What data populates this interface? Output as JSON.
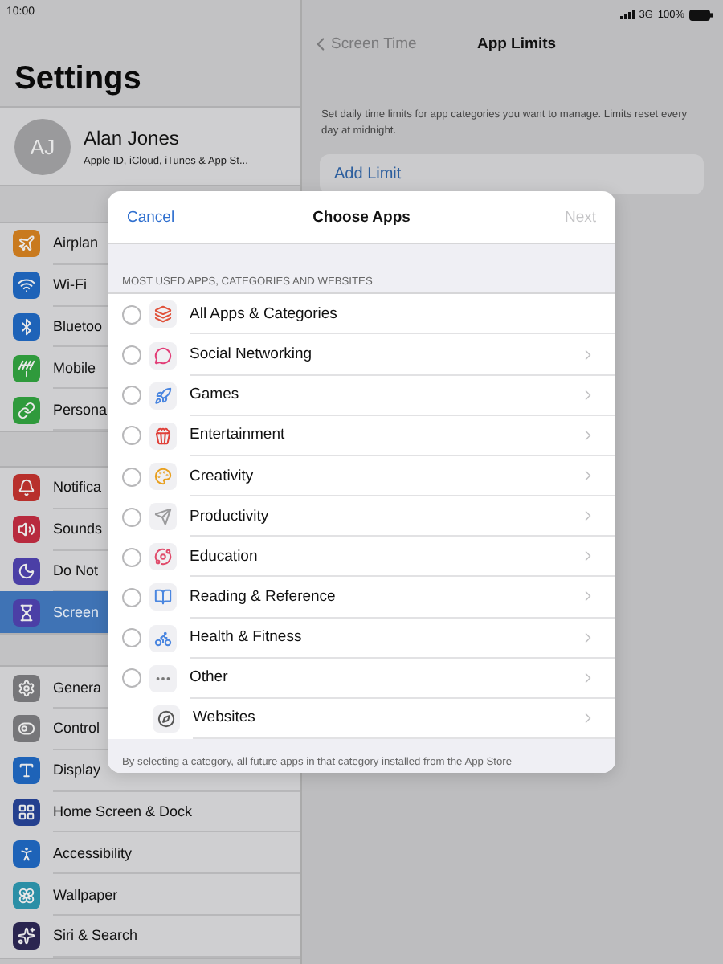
{
  "status_bar": {
    "time": "10:00",
    "network": "3G",
    "battery": "100%"
  },
  "sidebar": {
    "title": "Settings",
    "profile": {
      "initials": "AJ",
      "name": "Alan Jones",
      "subtitle": "Apple ID, iCloud, iTunes & App St..."
    },
    "groups": [
      [
        {
          "label": "Airplan",
          "color": "#c97a1e",
          "selected": false
        },
        {
          "label": "Wi-Fi",
          "color": "#1e63b8",
          "selected": false
        },
        {
          "label": "Bluetoo",
          "color": "#1e63b8",
          "selected": false
        },
        {
          "label": "Mobile",
          "color": "#2f9a3c",
          "selected": false
        },
        {
          "label": "Persona",
          "color": "#2f9a3c",
          "selected": false
        }
      ],
      [
        {
          "label": "Notifica",
          "color": "#b8302c",
          "selected": false
        },
        {
          "label": "Sounds",
          "color": "#b82a3e",
          "selected": false
        },
        {
          "label": "Do Not",
          "color": "#4b3fa6",
          "selected": false
        },
        {
          "label": "Screen",
          "color": "#4b3fa6",
          "selected": true
        }
      ],
      [
        {
          "label": "Genera",
          "color": "#767679",
          "selected": false
        },
        {
          "label": "Control",
          "color": "#767679",
          "selected": false
        },
        {
          "label": "Display",
          "color": "#1e63b8",
          "selected": false
        },
        {
          "label": "Home Screen & Dock",
          "color": "#25408f",
          "selected": false
        },
        {
          "label": "Accessibility",
          "color": "#1e63b8",
          "selected": false
        },
        {
          "label": "Wallpaper",
          "color": "#2b8fa6",
          "selected": false
        },
        {
          "label": "Siri & Search",
          "color": "#2a2550",
          "selected": false
        }
      ]
    ]
  },
  "detail": {
    "back": "Screen Time",
    "title": "App Limits",
    "description": "Set daily time limits for app categories you want to manage. Limits reset every day at midnight.",
    "action": "Add Limit"
  },
  "dialog": {
    "cancel": "Cancel",
    "title": "Choose Apps",
    "next": "Next",
    "next_disabled": true,
    "section_header": "MOST USED APPS, CATEGORIES AND WEBSITES",
    "rows": [
      {
        "kind": "radio",
        "label": "All Apps & Categories",
        "selected": false,
        "chevron": false
      },
      {
        "kind": "radio",
        "label": "Social Networking",
        "selected": false,
        "chevron": true
      },
      {
        "kind": "radio",
        "label": "Games",
        "selected": false,
        "chevron": true
      },
      {
        "kind": "radio",
        "label": "Entertainment",
        "selected": false,
        "chevron": true
      },
      {
        "kind": "radio",
        "label": "Creativity",
        "selected": false,
        "chevron": true
      },
      {
        "kind": "radio",
        "label": "Productivity",
        "selected": false,
        "chevron": true
      },
      {
        "kind": "radio",
        "label": "Education",
        "selected": false,
        "chevron": true
      },
      {
        "kind": "radio",
        "label": "Reading & Reference",
        "selected": false,
        "chevron": true
      },
      {
        "kind": "radio",
        "label": "Health & Fitness",
        "selected": false,
        "chevron": true
      },
      {
        "kind": "radio",
        "label": "Other",
        "selected": false,
        "chevron": true
      },
      {
        "kind": "plain",
        "label": "Websites",
        "chevron": true
      }
    ],
    "footer": "By selecting a category, all future apps in that category installed from the App Store"
  }
}
